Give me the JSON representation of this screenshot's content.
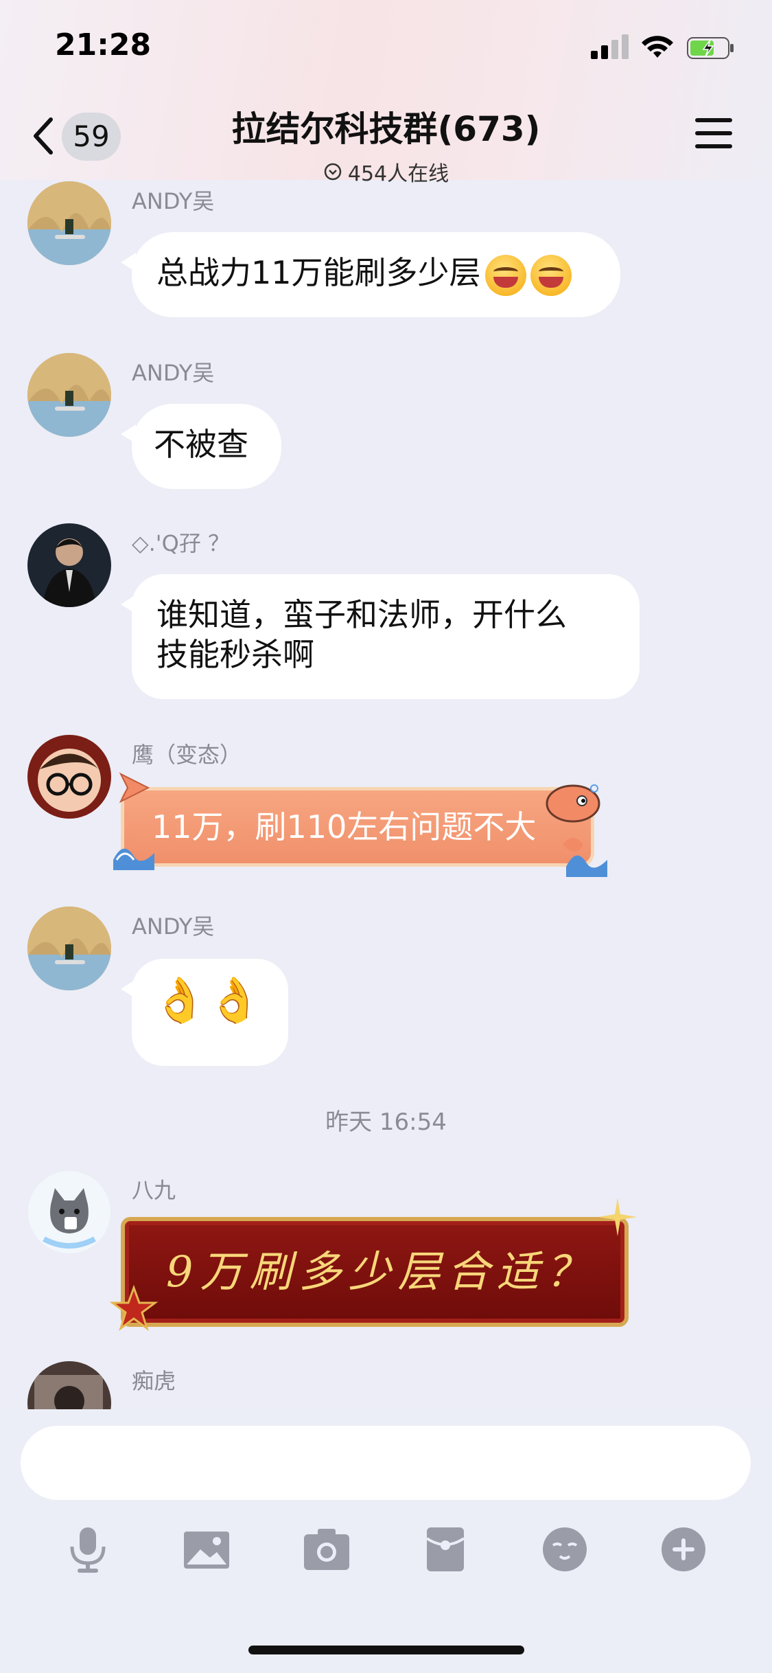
{
  "status_bar": {
    "time": "21:28"
  },
  "header": {
    "unread_count": "59",
    "title": "拉结尔科技群(673)",
    "online_text": "454人在线"
  },
  "messages": [
    {
      "sender": "ANDY吴",
      "text": "总战力11万能刷多少层"
    },
    {
      "sender": "ANDY吴",
      "text": "不被查"
    },
    {
      "sender": "◇.'Q孖 ？",
      "line1": "谁知道，蛮子和法师，开什么",
      "line2": "技能秒杀啊"
    },
    {
      "sender": "鹰（变态）",
      "text": "11万，刷110左右问题不大"
    },
    {
      "sender": "ANDY吴",
      "text": "👌👌"
    },
    {
      "sender": "八九",
      "text": "9万刷多少层合适？"
    },
    {
      "sender": "痴虎"
    }
  ],
  "timestamp": "昨天 16:54",
  "toolbar": {
    "icons": [
      "microphone-icon",
      "image-icon",
      "camera-icon",
      "red-packet-icon",
      "emoji-icon",
      "plus-icon"
    ]
  },
  "colors": {
    "accent": "#7c7f8c",
    "bubble": "#ffffff",
    "fish_bubble": "#f09470",
    "red_bubble": "#7a0f0c"
  }
}
